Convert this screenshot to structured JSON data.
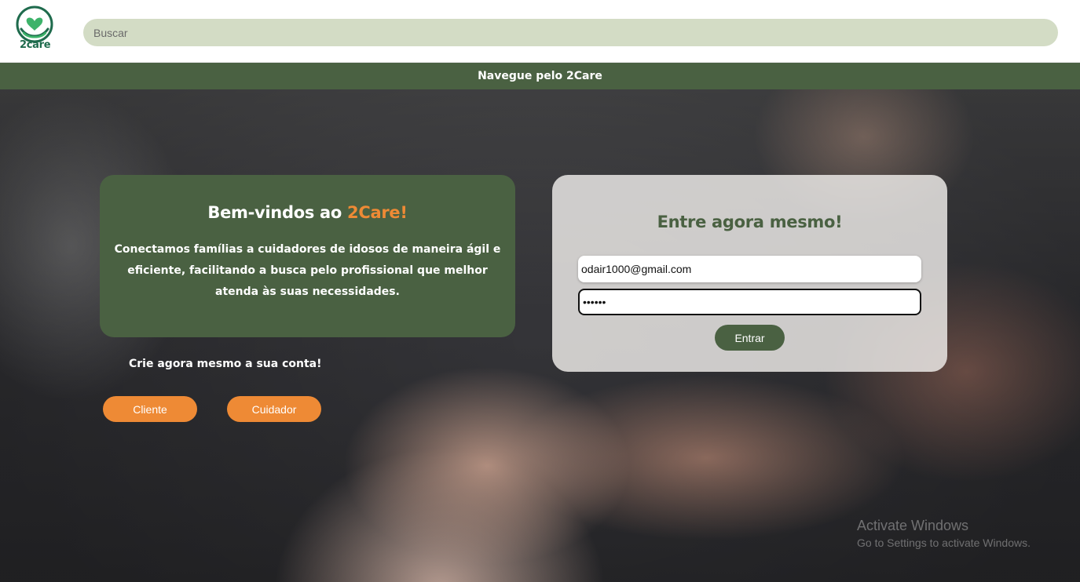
{
  "header": {
    "logo_text": "2care",
    "search_placeholder": "Buscar"
  },
  "navbar": {
    "label": "Navegue pelo 2Care"
  },
  "welcome": {
    "title_prefix": "Bem-vindos ao ",
    "title_brand": "2Care!",
    "text": "Conectamos famílias a cuidadores de idosos de maneira ágil e eficiente, facilitando a busca pelo profissional que melhor atenda às suas necessidades."
  },
  "signup": {
    "label": "Crie agora mesmo a sua conta!",
    "client_button": "Cliente",
    "caregiver_button": "Cuidador"
  },
  "login": {
    "title": "Entre agora mesmo!",
    "email_value": "odair1000@gmail.com",
    "password_value": "••••••",
    "submit_label": "Entrar"
  },
  "watermark": {
    "line1": "Activate Windows",
    "line2": "Go to Settings to activate Windows."
  },
  "colors": {
    "brand_green": "#4a6142",
    "accent_orange": "#ee8a35",
    "search_bg": "#d3dcc5"
  },
  "icons": {
    "logo": "heart-in-hands-icon"
  }
}
